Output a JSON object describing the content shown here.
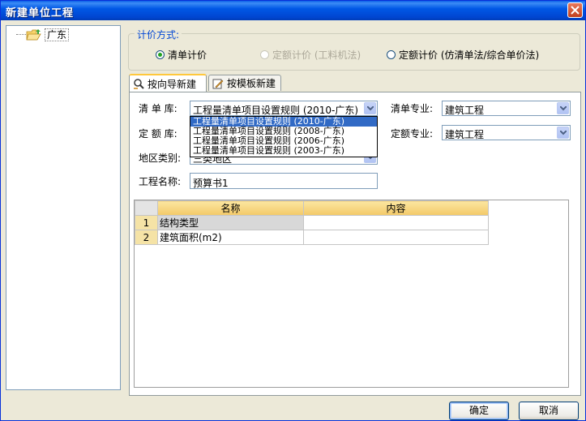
{
  "window": {
    "title": "新建单位工程",
    "close_icon": "close-icon"
  },
  "tree": {
    "items": [
      {
        "label": "广东",
        "icon": "folder-open-icon"
      }
    ]
  },
  "pricing": {
    "group_title": "计价方式:",
    "options": [
      {
        "label": "清单计价",
        "selected": true,
        "disabled": false
      },
      {
        "label": "定额计价 (工料机法)",
        "selected": false,
        "disabled": true
      },
      {
        "label": "定额计价 (仿清单法/综合单价法)",
        "selected": false,
        "disabled": false
      }
    ]
  },
  "tabs": [
    {
      "label": "按向导新建",
      "icon": "wizard-icon",
      "active": true
    },
    {
      "label": "按模板新建",
      "icon": "template-icon",
      "active": false
    }
  ],
  "form": {
    "list_lib_label": "清 单 库:",
    "list_lib_value": "工程量清单项目设置规则 (2010-广东)",
    "quota_lib_label": "定 额 库:",
    "region_label": "地区类别:",
    "region_value": "三类地区",
    "project_name_label": "工程名称:",
    "project_name_value": "预算书1",
    "list_major_label": "清单专业:",
    "list_major_value": "建筑工程",
    "quota_major_label": "定额专业:",
    "quota_major_value": "建筑工程"
  },
  "dropdown": {
    "options": [
      "工程量清单项目设置规则 (2010-广东)",
      "工程量清单项目设置规则 (2008-广东)",
      "工程量清单项目设置规则 (2006-广东)",
      "工程量清单项目设置规则 (2003-广东)"
    ],
    "selected_index": 0
  },
  "grid": {
    "headers": [
      "名称",
      "内容"
    ],
    "rows": [
      {
        "num": "1",
        "name": "结构类型",
        "value": ""
      },
      {
        "num": "2",
        "name": "建筑面积(m2)",
        "value": ""
      }
    ]
  },
  "buttons": {
    "ok": "确定",
    "cancel": "取消"
  },
  "colors": {
    "title_bar": "#0058E6",
    "selection": "#316AC5",
    "grid_header": "#F3C968"
  }
}
